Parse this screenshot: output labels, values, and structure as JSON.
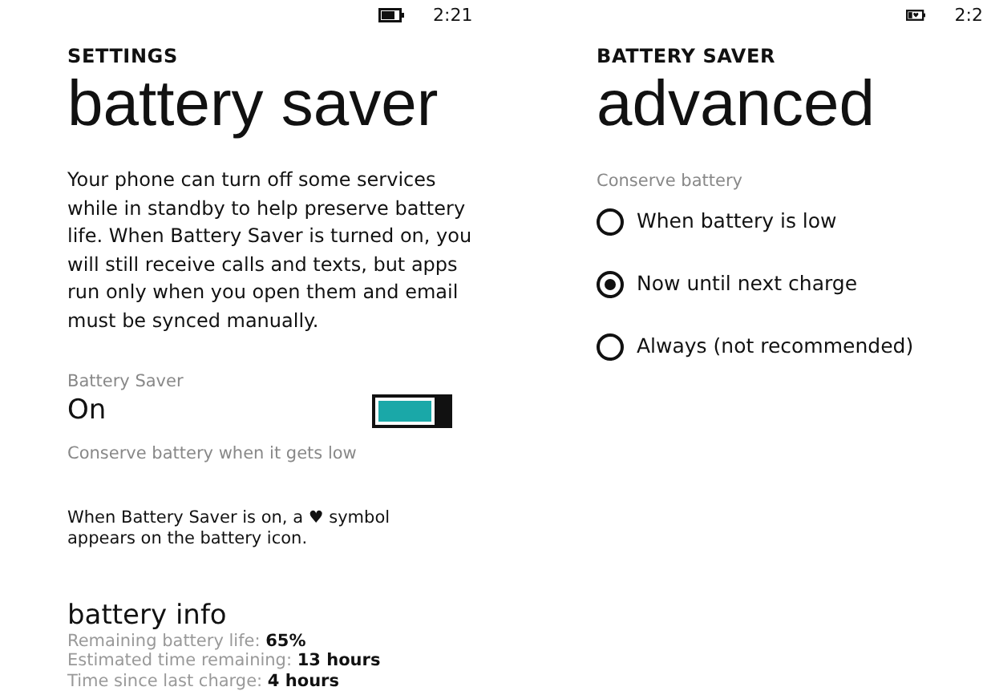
{
  "left_screen": {
    "status_bar": {
      "time": "2:21",
      "battery_saver_symbol": false
    },
    "app_title": "SETTINGS",
    "page_title": "battery saver",
    "description": "Your phone can turn off some services while in standby to help preserve battery life. When Battery Saver is turned on, you will still receive calls and texts, but apps run only when you open them and email must be synced manually.",
    "battery_saver": {
      "label": "Battery Saver",
      "state_text": "On",
      "on": true
    },
    "link": "Conserve battery when it gets low",
    "note": "When Battery Saver is on, a ♥ symbol appears on the battery icon.",
    "battery_info": {
      "title": "battery info",
      "lines": [
        "Remaining battery life: **65%**",
        "Estimated time remaining: **13 hours**",
        "Time since last charge: **4 hours**"
      ]
    }
  },
  "right_screen": {
    "status_bar": {
      "time": "2:2",
      "battery_saver_symbol": true
    },
    "app_title": "BATTERY SAVER",
    "page_title": "advanced",
    "group_label": "Conserve battery",
    "options": [
      {
        "label": "When battery is low",
        "selected": false
      },
      {
        "label": "Now until next charge",
        "selected": true
      },
      {
        "label": "Always (not recommended)",
        "selected": false
      }
    ]
  }
}
